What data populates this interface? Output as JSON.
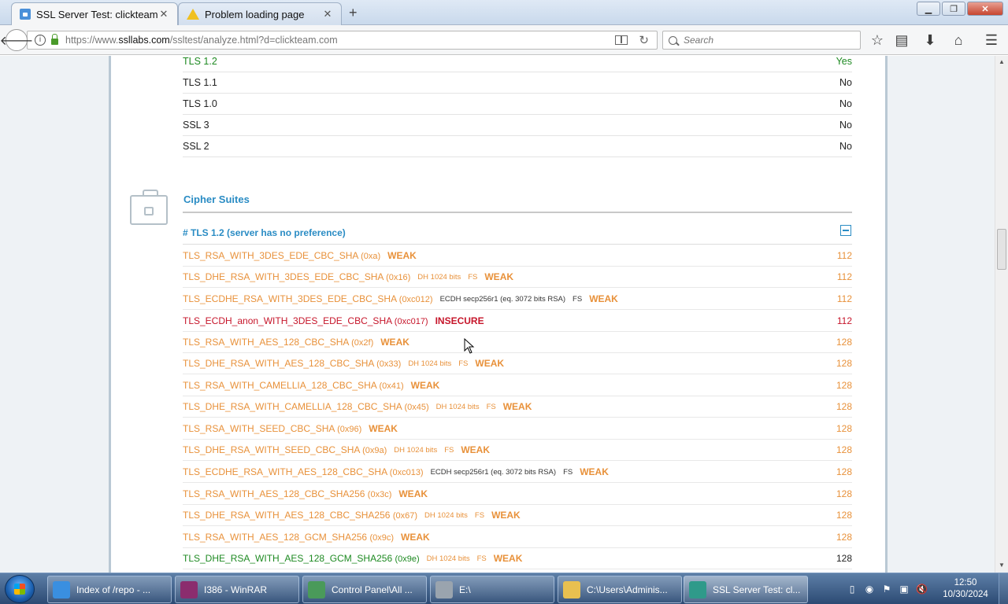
{
  "browser": {
    "tabs": [
      {
        "label": "SSL Server Test: clickteam.co",
        "icon": "lock-favicon",
        "active": true
      },
      {
        "label": "Problem loading page",
        "icon": "warning-favicon",
        "active": false
      }
    ],
    "new_tab_label": "+",
    "url": {
      "prefix": "https://www.",
      "host": "ssllabs.com",
      "path": "/ssltest/analyze.html?d=clickteam.com"
    },
    "search_placeholder": "Search"
  },
  "protocols": [
    {
      "name": "TLS 1.2",
      "value": "Yes",
      "highlight": true
    },
    {
      "name": "TLS 1.1",
      "value": "No"
    },
    {
      "name": "TLS 1.0",
      "value": "No"
    },
    {
      "name": "SSL 3",
      "value": "No"
    },
    {
      "name": "SSL 2",
      "value": "No"
    }
  ],
  "cipher_section": {
    "title": "Cipher Suites",
    "subheader": "# TLS 1.2 (server has no preference)"
  },
  "ciphers": [
    {
      "name": "TLS_RSA_WITH_3DES_EDE_CBC_SHA",
      "code": "(0xa)",
      "extra": "",
      "fs": "",
      "label": "WEAK",
      "bits": "112",
      "status": "weak"
    },
    {
      "name": "TLS_DHE_RSA_WITH_3DES_EDE_CBC_SHA",
      "code": "(0x16)",
      "extra": "DH 1024 bits",
      "fs": "FS",
      "label": "WEAK",
      "bits": "112",
      "status": "weak"
    },
    {
      "name": "TLS_ECDHE_RSA_WITH_3DES_EDE_CBC_SHA",
      "code": "(0xc012)",
      "extra": "ECDH secp256r1 (eq. 3072 bits RSA)",
      "fs": "FS",
      "label": "WEAK",
      "bits": "112",
      "status": "weak",
      "extra_gray": true
    },
    {
      "name": "TLS_ECDH_anon_WITH_3DES_EDE_CBC_SHA",
      "code": "(0xc017)",
      "extra": "",
      "fs": "",
      "label": "INSECURE",
      "bits": "112",
      "status": "insecure"
    },
    {
      "name": "TLS_RSA_WITH_AES_128_CBC_SHA",
      "code": "(0x2f)",
      "extra": "",
      "fs": "",
      "label": "WEAK",
      "bits": "128",
      "status": "weak"
    },
    {
      "name": "TLS_DHE_RSA_WITH_AES_128_CBC_SHA",
      "code": "(0x33)",
      "extra": "DH 1024 bits",
      "fs": "FS",
      "label": "WEAK",
      "bits": "128",
      "status": "weak"
    },
    {
      "name": "TLS_RSA_WITH_CAMELLIA_128_CBC_SHA",
      "code": "(0x41)",
      "extra": "",
      "fs": "",
      "label": "WEAK",
      "bits": "128",
      "status": "weak"
    },
    {
      "name": "TLS_DHE_RSA_WITH_CAMELLIA_128_CBC_SHA",
      "code": "(0x45)",
      "extra": "DH 1024 bits",
      "fs": "FS",
      "label": "WEAK",
      "bits": "128",
      "status": "weak"
    },
    {
      "name": "TLS_RSA_WITH_SEED_CBC_SHA",
      "code": "(0x96)",
      "extra": "",
      "fs": "",
      "label": "WEAK",
      "bits": "128",
      "status": "weak"
    },
    {
      "name": "TLS_DHE_RSA_WITH_SEED_CBC_SHA",
      "code": "(0x9a)",
      "extra": "DH 1024 bits",
      "fs": "FS",
      "label": "WEAK",
      "bits": "128",
      "status": "weak"
    },
    {
      "name": "TLS_ECDHE_RSA_WITH_AES_128_CBC_SHA",
      "code": "(0xc013)",
      "extra": "ECDH secp256r1 (eq. 3072 bits RSA)",
      "fs": "FS",
      "label": "WEAK",
      "bits": "128",
      "status": "weak",
      "extra_gray": true
    },
    {
      "name": "TLS_RSA_WITH_AES_128_CBC_SHA256",
      "code": "(0x3c)",
      "extra": "",
      "fs": "",
      "label": "WEAK",
      "bits": "128",
      "status": "weak"
    },
    {
      "name": "TLS_DHE_RSA_WITH_AES_128_CBC_SHA256",
      "code": "(0x67)",
      "extra": "DH 1024 bits",
      "fs": "FS",
      "label": "WEAK",
      "bits": "128",
      "status": "weak"
    },
    {
      "name": "TLS_RSA_WITH_AES_128_GCM_SHA256",
      "code": "(0x9c)",
      "extra": "",
      "fs": "",
      "label": "WEAK",
      "bits": "128",
      "status": "weak"
    },
    {
      "name": "TLS_DHE_RSA_WITH_AES_128_GCM_SHA256",
      "code": "(0x9e)",
      "extra": "DH 1024 bits",
      "fs": "FS",
      "label": "WEAK",
      "bits": "128",
      "status": "ok"
    }
  ],
  "taskbar": {
    "items": [
      {
        "label": "Index of /repo - ...",
        "icon": "ie-icon"
      },
      {
        "label": "I386 - WinRAR",
        "icon": "winrar-icon"
      },
      {
        "label": "Control Panel\\All ...",
        "icon": "control-panel-icon"
      },
      {
        "label": "E:\\",
        "icon": "drive-icon"
      },
      {
        "label": "C:\\Users\\Adminis...",
        "icon": "folder-icon"
      },
      {
        "label": "SSL Server Test: cl...",
        "icon": "browser-icon",
        "active": true
      }
    ],
    "clock_time": "12:50",
    "clock_date": "10/30/2024"
  },
  "colors": {
    "weak": "#e8913a",
    "insecure": "#c6152a",
    "ok": "#1e8a22",
    "accent": "#2a8cc4"
  }
}
